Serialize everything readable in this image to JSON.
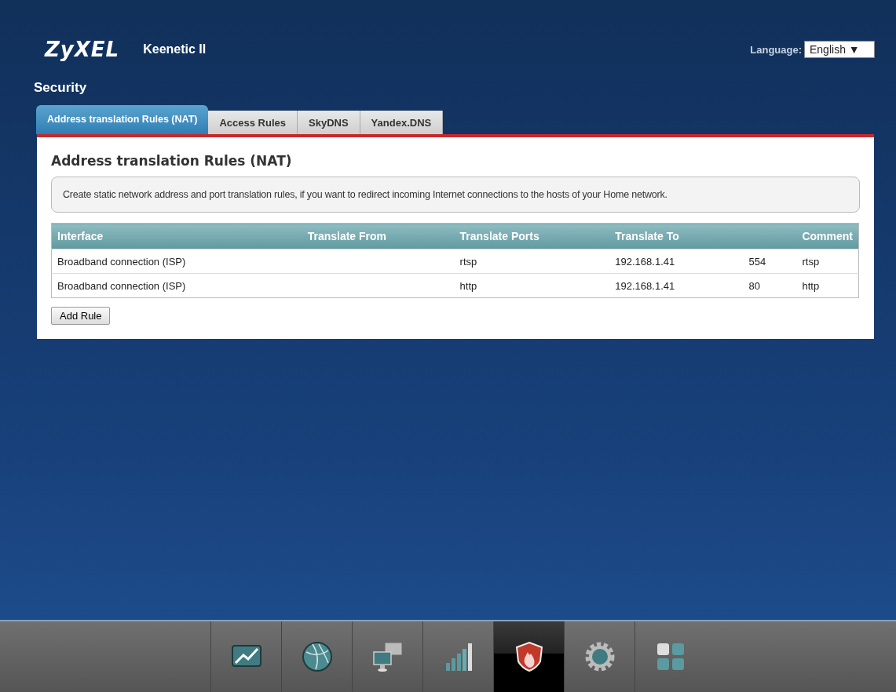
{
  "header": {
    "logo": "ZyXEL",
    "model": "Keenetic II",
    "language_label": "Language:",
    "language_value": "English ▼"
  },
  "page_title": "Security",
  "tabs": [
    {
      "label": "Address translation Rules (NAT)",
      "selected": true
    },
    {
      "label": "Access Rules",
      "selected": false
    },
    {
      "label": "SkyDNS",
      "selected": false
    },
    {
      "label": "Yandex.DNS",
      "selected": false
    }
  ],
  "panel": {
    "title": "Address translation Rules (NAT)",
    "note": "Create static network address and port translation rules, if you want to redirect incoming Internet connections to the hosts of your Home network.",
    "table": {
      "columns": [
        "Interface",
        "Translate From",
        "Translate Ports",
        "Translate To",
        "Comment"
      ],
      "rows": [
        {
          "interface": "Broadband connection (ISP)",
          "translate_ports": "rtsp",
          "translate_to": "192.168.1.41",
          "column_5": "554",
          "comment": "rtsp"
        },
        {
          "interface": "Broadband connection (ISP)",
          "translate_ports": "http",
          "translate_to": "192.168.1.41",
          "column_5": "80",
          "comment": "http"
        }
      ]
    },
    "add_button": "Add Rule"
  },
  "nav": [
    {
      "kind": "chart",
      "selected": false
    },
    {
      "kind": "globe",
      "selected": false
    },
    {
      "kind": "computers",
      "selected": false
    },
    {
      "kind": "signal",
      "selected": false
    },
    {
      "kind": "shield",
      "selected": true
    },
    {
      "kind": "gear",
      "selected": false
    },
    {
      "kind": "apps",
      "selected": false
    }
  ]
}
